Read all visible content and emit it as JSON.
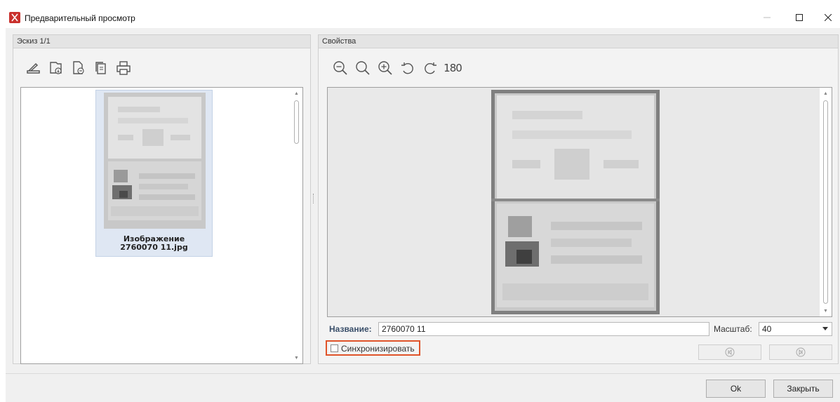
{
  "window": {
    "title": "Предварительный просмотр"
  },
  "left_panel": {
    "header": "Эскиз 1/1",
    "toolbar_icons": [
      "scan-icon",
      "add-file-icon",
      "remove-file-icon",
      "copy-icon",
      "print-icon"
    ],
    "thumbnail": {
      "caption_line1": "Изображение",
      "caption_line2": "2760070 11.jpg"
    }
  },
  "right_panel": {
    "header": "Свойства",
    "toolbar_icons": [
      "zoom-out-icon",
      "zoom-fit-icon",
      "zoom-in-icon",
      "rotate-left-icon",
      "rotate-right-icon",
      "rotate-180-icon"
    ],
    "rotate_180_label": "180",
    "name_label": "Название:",
    "name_value": "2760070 11",
    "scale_label": "Масштаб:",
    "scale_value": "40",
    "sync_label": "Синхронизировать",
    "sync_checked": false
  },
  "footer": {
    "ok_label": "Ok",
    "close_label": "Закрыть"
  },
  "colors": {
    "highlight": "#e0542a",
    "app_icon": "#c9302c",
    "selection": "#dfe7f3"
  }
}
